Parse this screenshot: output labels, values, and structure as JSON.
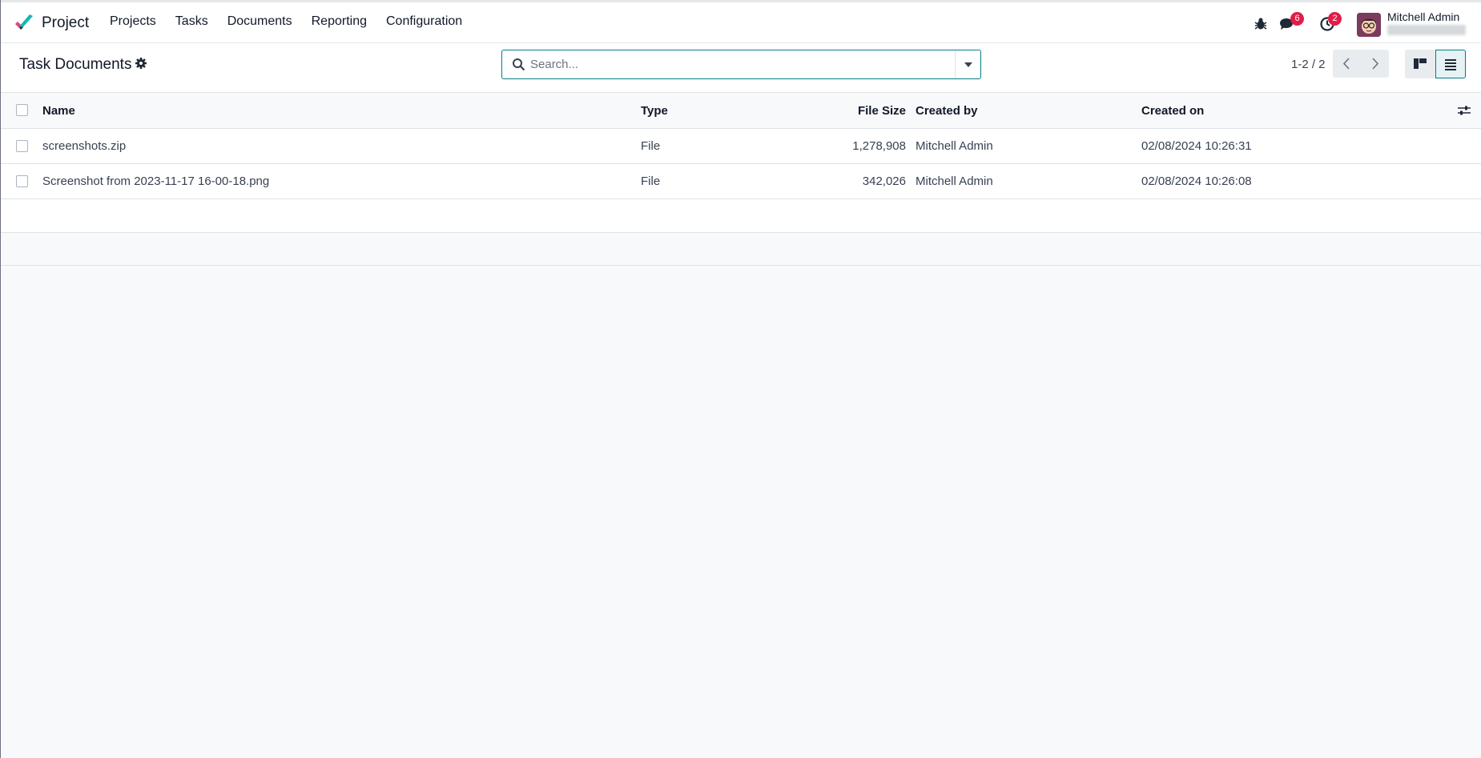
{
  "app": {
    "name": "Project"
  },
  "nav": {
    "items": [
      "Projects",
      "Tasks",
      "Documents",
      "Reporting",
      "Configuration"
    ]
  },
  "systray": {
    "messages_count": "6",
    "activities_count": "2",
    "user_name": "Mitchell Admin"
  },
  "control": {
    "title": "Task Documents",
    "search_placeholder": "Search...",
    "pager": "1-2 / 2"
  },
  "table": {
    "columns": {
      "name": "Name",
      "type": "Type",
      "size": "File Size",
      "created_by": "Created by",
      "created_on": "Created on"
    },
    "rows": [
      {
        "name": "screenshots.zip",
        "type": "File",
        "size": "1,278,908",
        "created_by": "Mitchell Admin",
        "created_on": "02/08/2024 10:26:31"
      },
      {
        "name": "Screenshot from 2023-11-17 16-00-18.png",
        "type": "File",
        "size": "342,026",
        "created_by": "Mitchell Admin",
        "created_on": "02/08/2024 10:26:08"
      }
    ]
  },
  "colors": {
    "accent": "#017e84",
    "badge": "#e11d48",
    "logo_teal": "#1ab5b0",
    "logo_pink": "#e0437e",
    "logo_dark": "#1f2a44"
  },
  "icons": [
    "project-logo-icon",
    "bug-icon",
    "chat-icon",
    "clock-icon",
    "gear-icon",
    "search-icon",
    "caret-down-icon",
    "chevron-left-icon",
    "chevron-right-icon",
    "kanban-icon",
    "list-icon",
    "sliders-icon"
  ]
}
